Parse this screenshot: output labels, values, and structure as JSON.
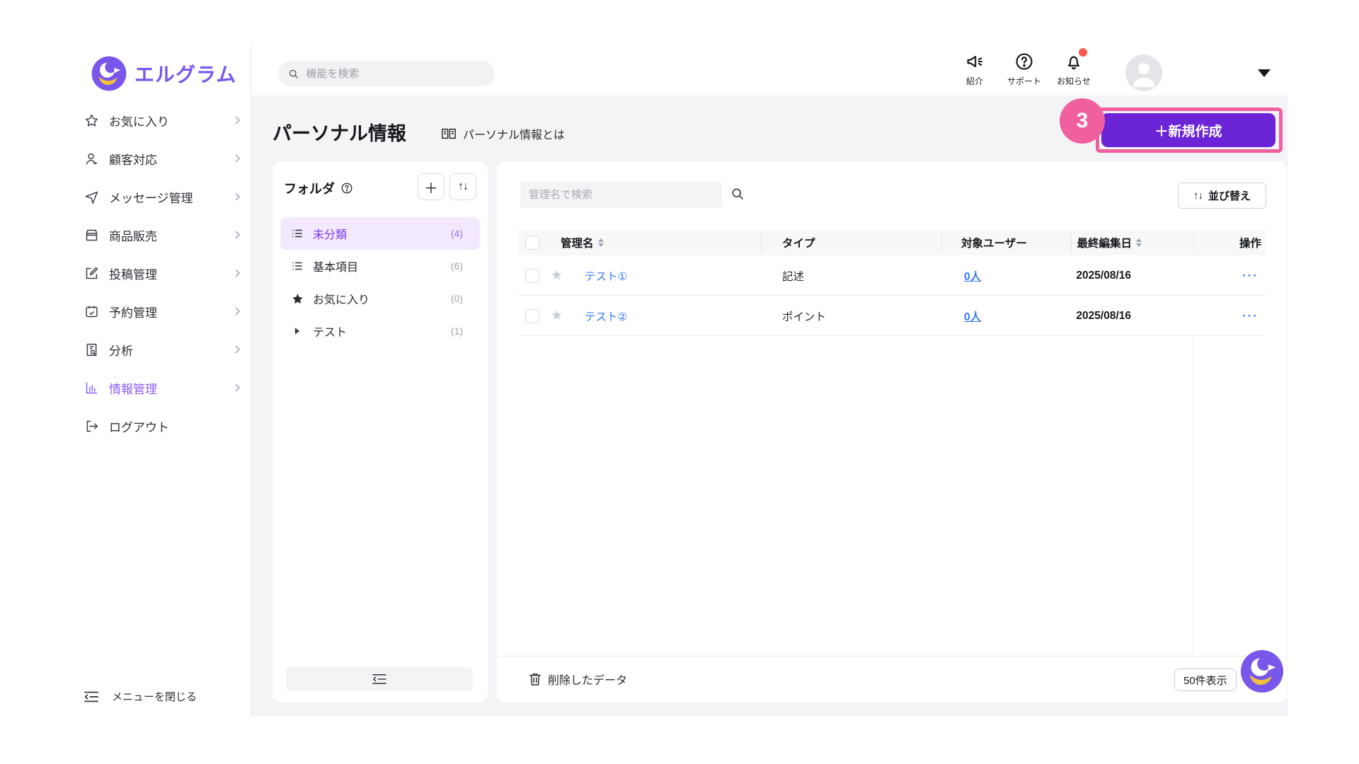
{
  "brand": {
    "name": "エルグラム"
  },
  "topbar": {
    "search_placeholder": "機能を検索",
    "actions": [
      {
        "label": "紹介",
        "icon": "megaphone-icon"
      },
      {
        "label": "サポート",
        "icon": "help-circle-icon"
      },
      {
        "label": "お知らせ",
        "icon": "bell-icon",
        "has_notification_dot": true
      }
    ]
  },
  "sidebar": {
    "items": [
      {
        "label": "お気に入り",
        "icon": "star-outline-icon"
      },
      {
        "label": "顧客対応",
        "icon": "person-icon"
      },
      {
        "label": "メッセージ管理",
        "icon": "send-icon"
      },
      {
        "label": "商品販売",
        "icon": "storefront-icon"
      },
      {
        "label": "投稿管理",
        "icon": "edit-icon"
      },
      {
        "label": "予約管理",
        "icon": "calendar-icon"
      },
      {
        "label": "分析",
        "icon": "document-search-icon"
      },
      {
        "label": "情報管理",
        "icon": "bar-chart-icon",
        "active": true
      },
      {
        "label": "ログアウト",
        "icon": "logout-icon"
      }
    ],
    "close_label": "メニューを閉じる"
  },
  "page": {
    "title": "パーソナル情報",
    "help_link": "パーソナル情報とは",
    "create_button": "＋新規作成",
    "annotation_number": "3"
  },
  "folders": {
    "title": "フォルダ",
    "items": [
      {
        "label": "未分類",
        "count": "(4)",
        "icon": "list-icon",
        "active": true
      },
      {
        "label": "基本項目",
        "count": "(6)",
        "icon": "list-icon"
      },
      {
        "label": "お気に入り",
        "count": "(0)",
        "icon": "star-filled-icon"
      },
      {
        "label": "テスト",
        "count": "(1)",
        "icon": "caret-right-icon"
      }
    ]
  },
  "table": {
    "search_placeholder": "管理名で検索",
    "sort_label": "並び替え",
    "columns": [
      "管理名",
      "タイプ",
      "対象ユーザー",
      "最終編集日",
      "操作"
    ],
    "rows": [
      {
        "name": "テスト①",
        "type": "記述",
        "users": "0人",
        "date": "2025/08/16",
        "actions": "…"
      },
      {
        "name": "テスト②",
        "type": "ポイント",
        "users": "0人",
        "date": "2025/08/16",
        "actions": "…"
      }
    ],
    "footer": {
      "deleted_label": "削除したデータ",
      "page_size_label": "50件表示"
    }
  },
  "colors": {
    "brand_purple": "#7857ea",
    "button_purple": "#6b24d6",
    "active_purple": "#7c3aed",
    "highlight_pink": "#f0609f",
    "link_blue": "#3579f6",
    "notification_red": "#fa5a50",
    "content_bg": "#f4f4f6"
  }
}
